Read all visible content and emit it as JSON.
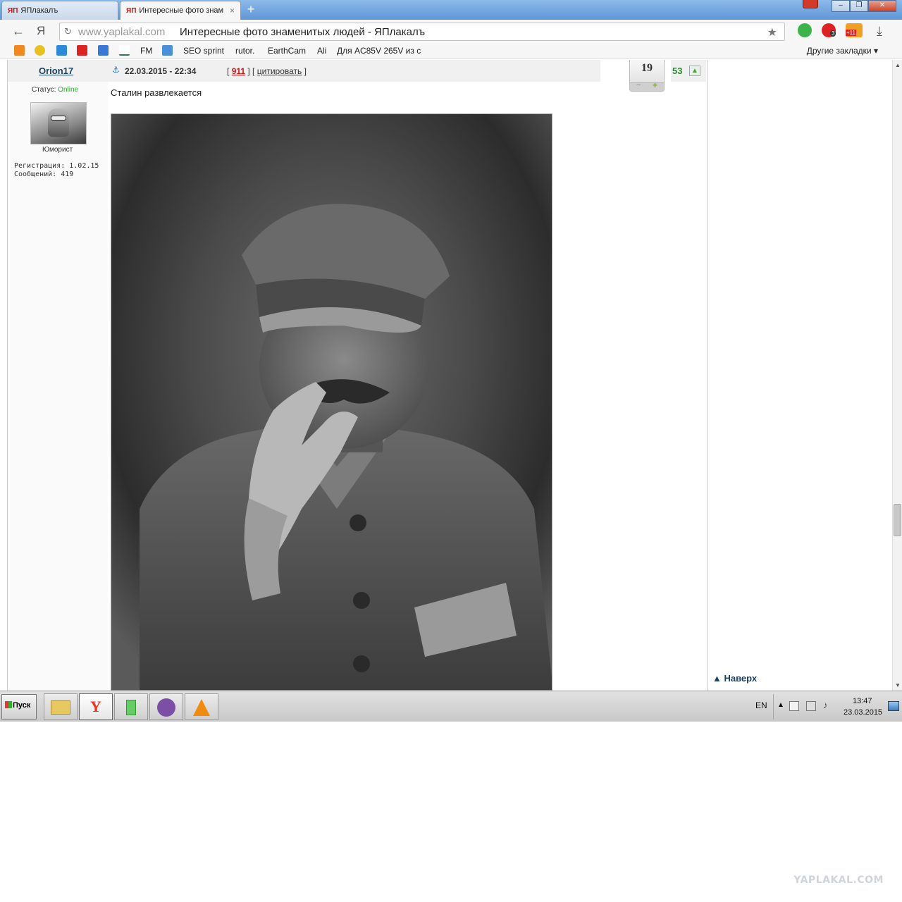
{
  "browser": {
    "tabs": [
      {
        "icon": "ЯП",
        "label": "ЯПлакалъ",
        "active": false
      },
      {
        "icon": "ЯП",
        "label": "Интересные фото знам",
        "active": true
      }
    ],
    "new_tab_symbol": "+",
    "close_tab_symbol": "×",
    "back_symbol": "←",
    "home_symbol": "Я",
    "reload_symbol": "↻",
    "address_domain": "www.yaplakal.com",
    "address_title": "Интересные фото знаменитых людей - ЯПлакалъ",
    "bookmark_star": "★",
    "download_symbol": "⤓",
    "extension_badge": "+11",
    "extension_count": "3",
    "window_buttons": {
      "minimize": "–",
      "maximize": "❐",
      "close": "✕"
    }
  },
  "bookmarks": {
    "items": [
      "FM",
      "SEO sprint",
      "rutor.",
      "EarthCam",
      "Ali",
      "Для AC85V 265V из с"
    ],
    "other": "Другие закладки ▾"
  },
  "post": {
    "author": "Orion17",
    "anchor_symbol": "⚓",
    "date": "22.03.2015 - 22:34",
    "links_open": "[",
    "number": "911",
    "links_mid": "] [",
    "quote": "цитировать",
    "links_close": "]",
    "status_label": "Статус:",
    "status_value": "Online",
    "rank": "Юморист",
    "registration": "Регистрация: 1.02.15",
    "messages": "Сообщений: 419",
    "rating": "19",
    "rating_minus": "−",
    "rating_plus": "+",
    "likes": "53",
    "text": "Сталин развлекается",
    "back_to_top": "▲ Наверх"
  },
  "taskbar": {
    "start_label": "Пуск",
    "apps": [
      "folder-icon",
      "yandex-browser-icon",
      "flask-icon",
      "viber-icon",
      "vlc-icon"
    ],
    "language": "EN",
    "time": "13:47",
    "date": "23.03.2015"
  },
  "watermark": "YAPLAKAL.COM",
  "colors": {
    "tabstrip": "#6aa0dc",
    "link": "#1c4262",
    "online": "#2fa82f",
    "post_number": "#cc1a1a",
    "likes": "#2f8a2f"
  }
}
